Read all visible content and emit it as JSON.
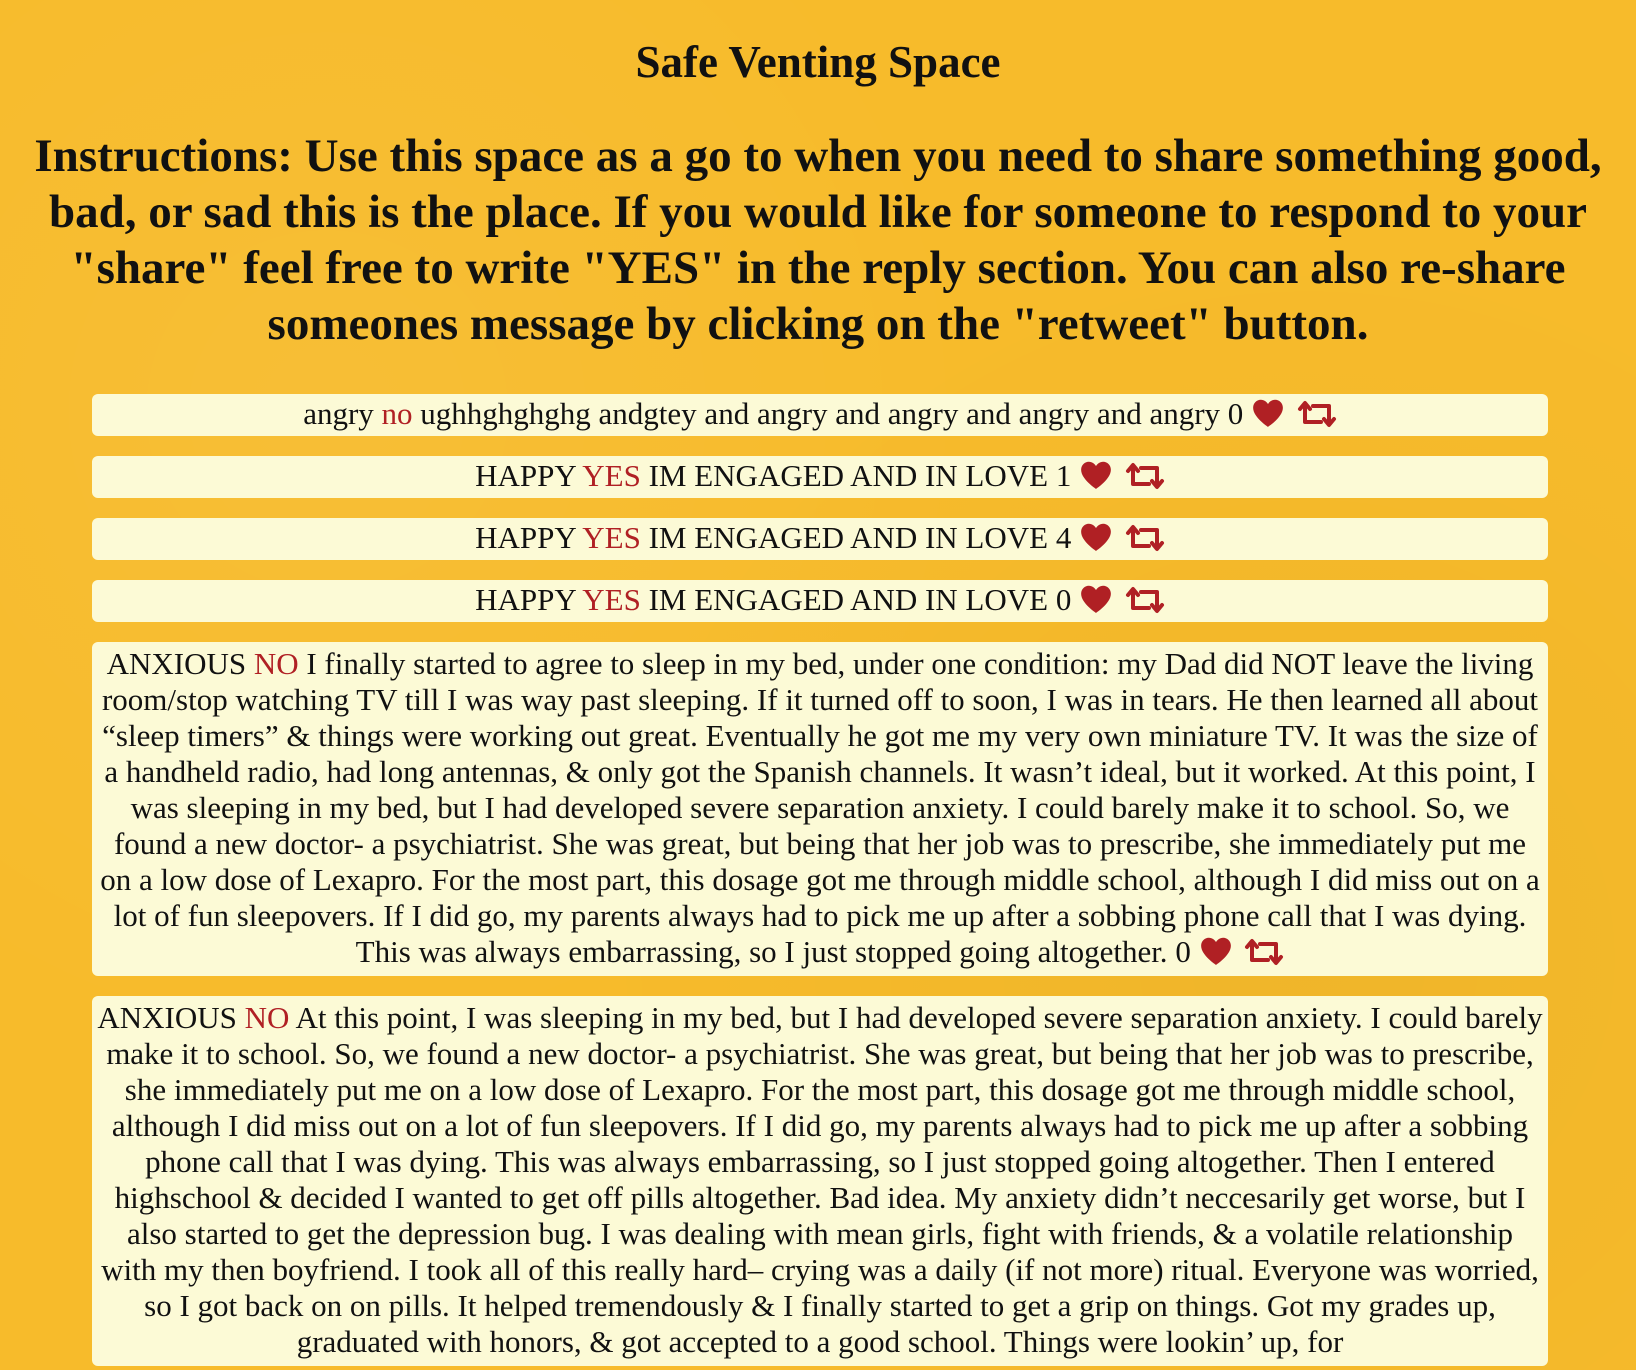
{
  "page": {
    "title": "Safe Venting Space",
    "instructions": "Instructions: Use this space as a go to when you need to share something good, bad, or sad this is the place. If you would like for someone to respond to your \"share\" feel free to write \"YES\" in the reply section. You can also re-share someones message by clicking on the \"retweet\" button."
  },
  "colors": {
    "background": "#f7bb2b",
    "card": "#fcfad6",
    "accent": "#b02024"
  },
  "icons": {
    "like": "heart-icon",
    "share": "retweet-icon"
  },
  "posts": [
    {
      "mood": "angry",
      "reply": "no",
      "text": "ughhghghghg andgtey and angry and angry and angry and angry",
      "likes": "0"
    },
    {
      "mood": "HAPPY",
      "reply": "YES",
      "text": "IM ENGAGED AND IN LOVE",
      "likes": "1"
    },
    {
      "mood": "HAPPY",
      "reply": "YES",
      "text": "IM ENGAGED AND IN LOVE",
      "likes": "4"
    },
    {
      "mood": "HAPPY",
      "reply": "YES",
      "text": "IM ENGAGED AND IN LOVE",
      "likes": "0"
    },
    {
      "mood": "ANXIOUS",
      "reply": "NO",
      "text": "I finally started to agree to sleep in my bed, under one condition: my Dad did NOT leave the living room/stop watching TV till I was way past sleeping. If it turned off to soon, I was in tears. He then learned all about “sleep timers” & things were working out great. Eventually he got me my very own miniature TV. It was the size of a handheld radio, had long antennas, & only got the Spanish channels. It wasn’t ideal, but it worked. At this point, I was sleeping in my bed, but I had developed severe separation anxiety. I could barely make it to school. So, we found a new doctor- a psychiatrist. She was great, but being that her job was to prescribe, she immediately put me on a low dose of Lexapro. For the most part, this dosage got me through middle school, although I did miss out on a lot of fun sleepovers. If I did go, my parents always had to pick me up after a sobbing phone call that I was dying. This was always embarrassing, so I just stopped going altogether.",
      "likes": "0"
    },
    {
      "mood": "ANXIOUS",
      "reply": "NO",
      "text": "At this point, I was sleeping in my bed, but I had developed severe separation anxiety. I could barely make it to school. So, we found a new doctor- a psychiatrist. She was great, but being that her job was to prescribe, she immediately put me on a low dose of Lexapro. For the most part, this dosage got me through middle school, although I did miss out on a lot of fun sleepovers. If I did go, my parents always had to pick me up after a sobbing phone call that I was dying. This was always embarrassing, so I just stopped going altogether. Then I entered highschool & decided I wanted to get off pills altogether. Bad idea. My anxiety didn’t neccesarily get worse, but I also started to get the depression bug. I was dealing with mean girls, fight with friends, & a volatile relationship with my then boyfriend. I took all of this really hard– crying was a daily (if not more) ritual. Everyone was worried, so I got back on on pills. It helped tremendously & I finally started to get a grip on things. Got my grades up, graduated with honors, & got accepted to a good school. Things were lookin’ up, for",
      "likes": ""
    }
  ]
}
